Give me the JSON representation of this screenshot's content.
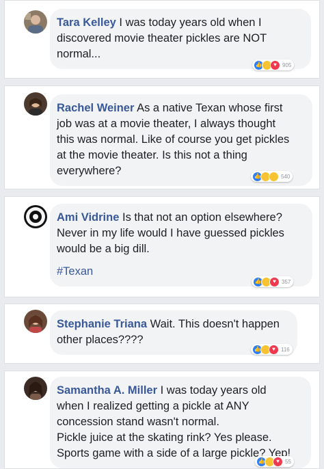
{
  "colors": {
    "name_link": "#385898",
    "like": "#2f7ef2",
    "haha": "#f7c332",
    "love": "#f0384e",
    "bubble": "#f2f3f5"
  },
  "comments": [
    {
      "author": "Tara Kelley",
      "lines": [
        "I was today years old when I",
        "discovered movie theater pickles are NOT",
        "normal..."
      ],
      "hashtag": "",
      "reactions": [
        "like-icon",
        "haha-icon",
        "love-icon"
      ],
      "reaction_count": "905"
    },
    {
      "author": "Rachel Weiner",
      "lines": [
        "As a native Texan whose first",
        "job was at a movie theater, I always thought",
        "this was normal. Like of course you get pickles",
        "at the movie theater. Is this not a thing",
        "everywhere?"
      ],
      "hashtag": "",
      "reactions": [
        "like-icon",
        "haha-icon",
        "wow-icon"
      ],
      "reaction_count": "540"
    },
    {
      "author": "Ami Vidrine",
      "lines": [
        "Is that not an option elsewhere?",
        "Never in my life would I have guessed pickles",
        "would be a big dill."
      ],
      "hashtag": "#Texan",
      "reactions": [
        "like-icon",
        "haha-icon",
        "love-icon"
      ],
      "reaction_count": "357"
    },
    {
      "author": "Stephanie Triana",
      "lines": [
        "Wait. This doesn't happen",
        "other places????"
      ],
      "hashtag": "",
      "reactions": [
        "like-icon",
        "haha-icon",
        "love-icon"
      ],
      "reaction_count": "116"
    },
    {
      "author": "Samantha A. Miller",
      "lines": [
        "I was today years old",
        "when I realized getting a pickle at ANY",
        "concession stand wasn't normal.",
        "Pickle juice at the skating rink? Yes please.",
        "Sports game with a side of a large pickle? Yep!"
      ],
      "hashtag": "",
      "reactions": [
        "like-icon",
        "wow-icon",
        "love-icon"
      ],
      "reaction_count": "55"
    }
  ]
}
